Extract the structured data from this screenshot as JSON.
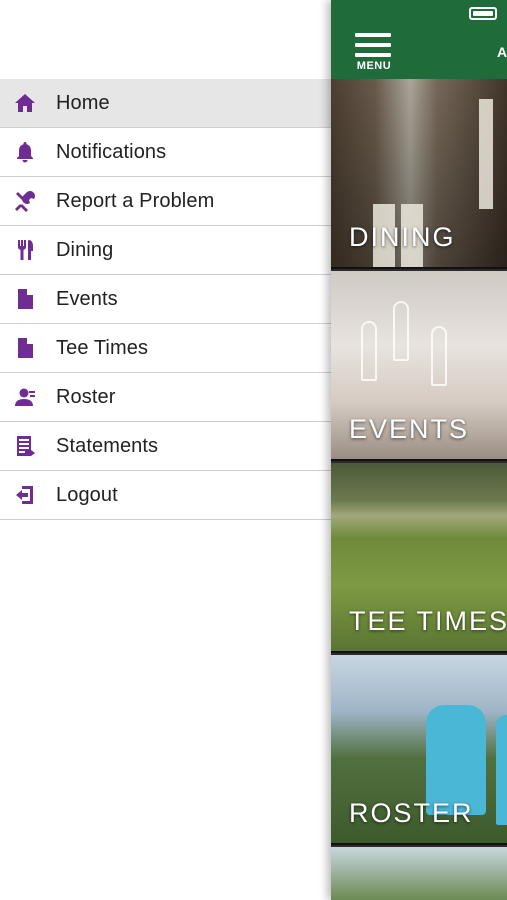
{
  "drawer": {
    "items": [
      {
        "label": "Home",
        "icon": "home-icon",
        "active": true
      },
      {
        "label": "Notifications",
        "icon": "bell-icon",
        "active": false
      },
      {
        "label": "Report a Problem",
        "icon": "tools-icon",
        "active": false
      },
      {
        "label": "Dining",
        "icon": "utensils-icon",
        "active": false
      },
      {
        "label": "Events",
        "icon": "document-icon",
        "active": false
      },
      {
        "label": "Tee Times",
        "icon": "document-icon",
        "active": false
      },
      {
        "label": "Roster",
        "icon": "person-icon",
        "active": false
      },
      {
        "label": "Statements",
        "icon": "statement-icon",
        "active": false
      },
      {
        "label": "Logout",
        "icon": "logout-icon",
        "active": false
      }
    ]
  },
  "topbar": {
    "menu_label": "MENU",
    "title": "A"
  },
  "tiles": [
    {
      "label": "DINING"
    },
    {
      "label": "EVENTS"
    },
    {
      "label": "TEE TIMES"
    },
    {
      "label": "ROSTER"
    }
  ],
  "colors": {
    "brand_green": "#1f6b3a",
    "icon_purple": "#6f2c91",
    "active_row": "#e6e6e6"
  }
}
